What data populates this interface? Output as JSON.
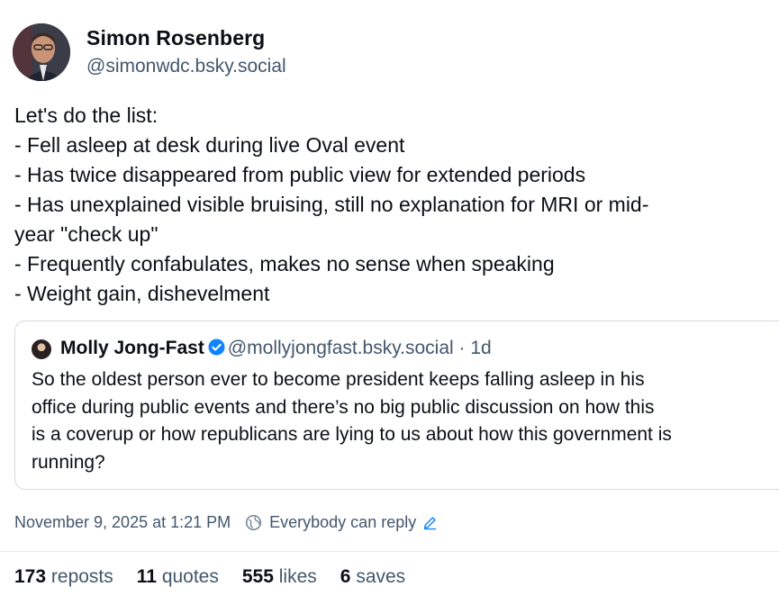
{
  "author": {
    "display_name": "Simon Rosenberg",
    "handle": "@simonwdc.bsky.social"
  },
  "post": {
    "lines": [
      "Let's do the list:",
      "- Fell asleep at desk during live Oval event",
      "- Has twice disappeared from public view for extended periods",
      "- Has unexplained visible bruising, still no explanation for MRI or mid-",
      "year \"check up\"",
      "- Frequently confabulates, makes no sense when speaking",
      "- Weight gain, dishevelment"
    ]
  },
  "quote": {
    "display_name": "Molly Jong-Fast",
    "handle": "@mollyjongfast.bsky.social",
    "age": "· 1d",
    "verified_icon": "verified-check-icon",
    "verified_color": "#1083fe",
    "lines": [
      "So the oldest person ever to become president keeps falling asleep in his",
      "office during public events and there’s no big public discussion on how this",
      "is a coverup or how republicans are lying to us about how this government is",
      "running?"
    ]
  },
  "meta": {
    "timestamp": "November 9, 2025 at 1:21 PM",
    "reply_setting": "Everybody can reply",
    "accent_color": "#1083fe"
  },
  "stats": {
    "reposts_count": "173",
    "reposts_label": "reposts",
    "quotes_count": "11",
    "quotes_label": "quotes",
    "likes_count": "555",
    "likes_label": "likes",
    "saves_count": "6",
    "saves_label": "saves"
  }
}
